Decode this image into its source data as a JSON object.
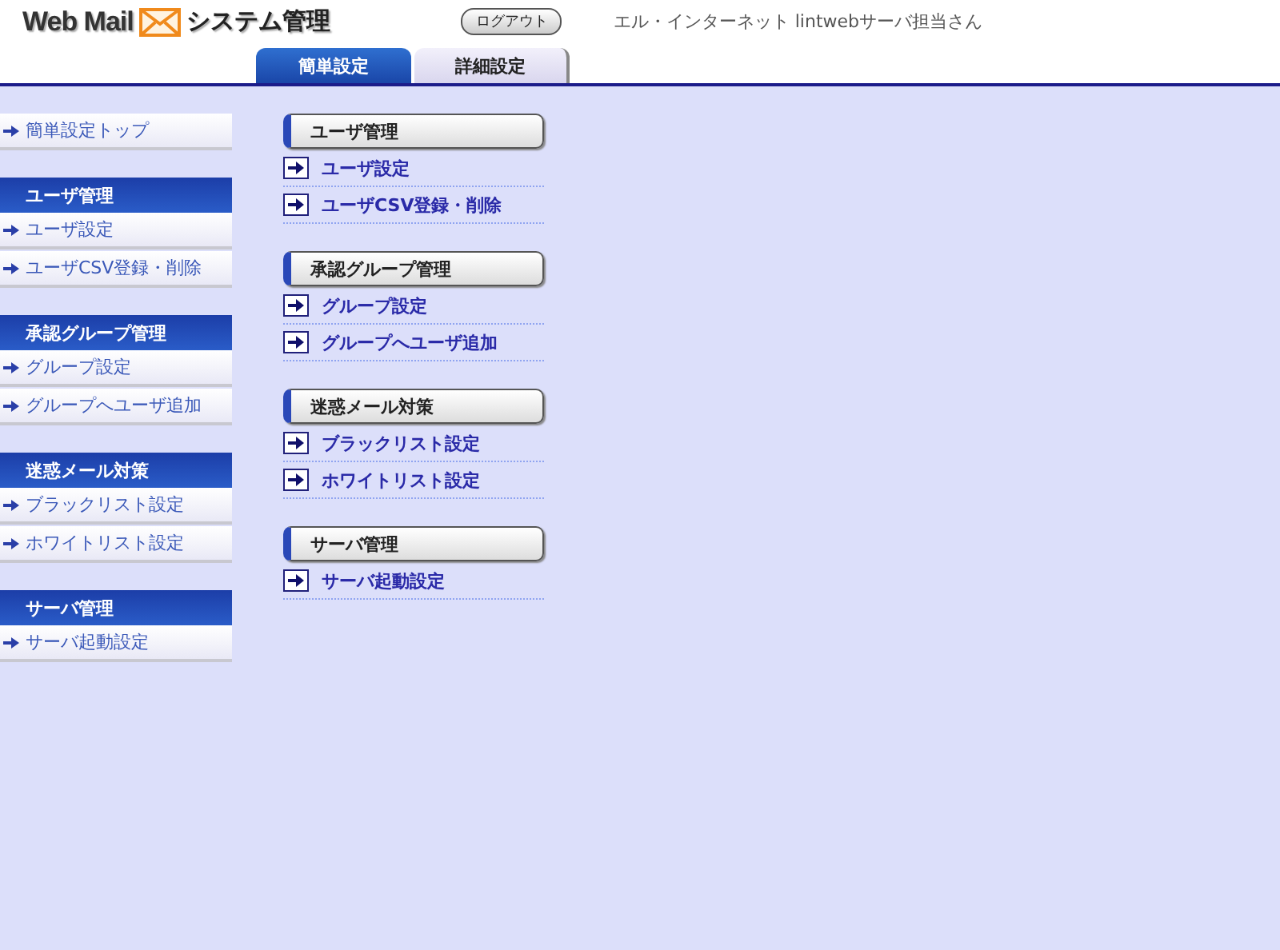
{
  "header": {
    "brand": "Web Mail",
    "title": "システム管理",
    "logout": "ログアウト",
    "user": "エル・インターネット lintwebサーバ担当さん"
  },
  "tabs": [
    {
      "label": "簡単設定",
      "selected": true
    },
    {
      "label": "詳細設定",
      "selected": false
    }
  ],
  "sidebar": {
    "top_link": "簡単設定トップ",
    "sections": [
      {
        "title": "ユーザ管理",
        "items": [
          "ユーザ設定",
          "ユーザCSV登録・削除"
        ]
      },
      {
        "title": "承認グループ管理",
        "items": [
          "グループ設定",
          "グループへユーザ追加"
        ]
      },
      {
        "title": "迷惑メール対策",
        "items": [
          "ブラックリスト設定",
          "ホワイトリスト設定"
        ]
      },
      {
        "title": "サーバ管理",
        "items": [
          "サーバ起動設定"
        ]
      }
    ]
  },
  "main": {
    "sections": [
      {
        "title": "ユーザ管理",
        "items": [
          "ユーザ設定",
          "ユーザCSV登録・削除"
        ]
      },
      {
        "title": "承認グループ管理",
        "items": [
          "グループ設定",
          "グループへユーザ追加"
        ]
      },
      {
        "title": "迷惑メール対策",
        "items": [
          "ブラックリスト設定",
          "ホワイトリスト設定"
        ]
      },
      {
        "title": "サーバ管理",
        "items": [
          "サーバ起動設定"
        ]
      }
    ]
  }
}
